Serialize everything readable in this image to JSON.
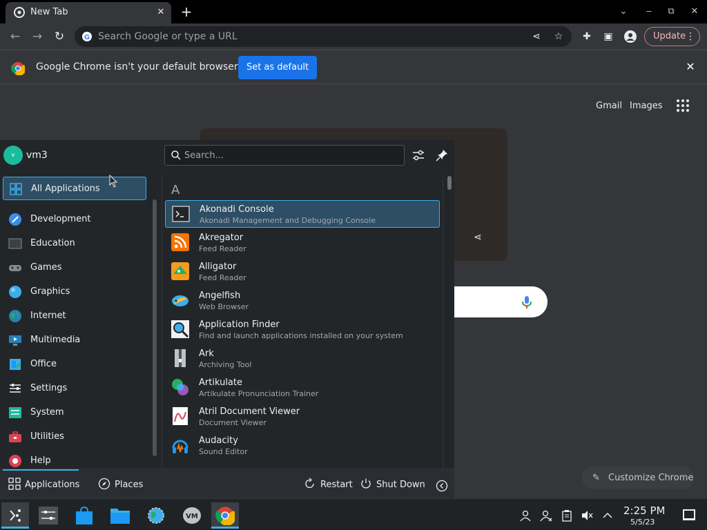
{
  "chrome": {
    "tab_title": "New Tab",
    "omnibox_placeholder": "Search Google or type a URL",
    "update_label": "Update",
    "infobar_text": "Google Chrome isn't your default browser",
    "set_default_label": "Set as default",
    "ntp_links": [
      "Gmail",
      "Images"
    ],
    "customize_label": "Customize Chrome"
  },
  "launcher": {
    "user": "vm3",
    "user_initial": "v",
    "search_placeholder": "Search...",
    "categories": [
      {
        "label": "All Applications",
        "icon": "grid-icon",
        "active": true
      },
      {
        "label": "Development",
        "icon": "development-icon"
      },
      {
        "label": "Education",
        "icon": "education-icon"
      },
      {
        "label": "Games",
        "icon": "gamepad-icon"
      },
      {
        "label": "Graphics",
        "icon": "graphics-icon"
      },
      {
        "label": "Internet",
        "icon": "globe-icon"
      },
      {
        "label": "Multimedia",
        "icon": "multimedia-icon"
      },
      {
        "label": "Office",
        "icon": "office-icon"
      },
      {
        "label": "Settings",
        "icon": "settings-icon"
      },
      {
        "label": "System",
        "icon": "system-icon"
      },
      {
        "label": "Utilities",
        "icon": "toolbox-icon"
      },
      {
        "label": "Help",
        "icon": "help-icon"
      }
    ],
    "section_letter": "A",
    "apps": [
      {
        "name": "Akonadi Console",
        "desc": "Akonadi Management and Debugging Console",
        "active": true
      },
      {
        "name": "Akregator",
        "desc": "Feed Reader"
      },
      {
        "name": "Alligator",
        "desc": "Feed Reader"
      },
      {
        "name": "Angelfish",
        "desc": "Web Browser"
      },
      {
        "name": "Application Finder",
        "desc": "Find and launch applications installed on your system"
      },
      {
        "name": "Ark",
        "desc": "Archiving Tool"
      },
      {
        "name": "Artikulate",
        "desc": "Artikulate Pronunciation Trainer"
      },
      {
        "name": "Atril Document Viewer",
        "desc": "Document Viewer"
      },
      {
        "name": "Audacity",
        "desc": "Sound Editor"
      }
    ],
    "footer": {
      "applications": "Applications",
      "places": "Places",
      "restart": "Restart",
      "shutdown": "Shut Down"
    }
  },
  "taskbar": {
    "time": "2:25 PM",
    "date": "5/5/23"
  },
  "colors": {
    "accent": "#3daee9",
    "chrome_blue": "#1a73e8",
    "launcher_bg": "#232629"
  }
}
